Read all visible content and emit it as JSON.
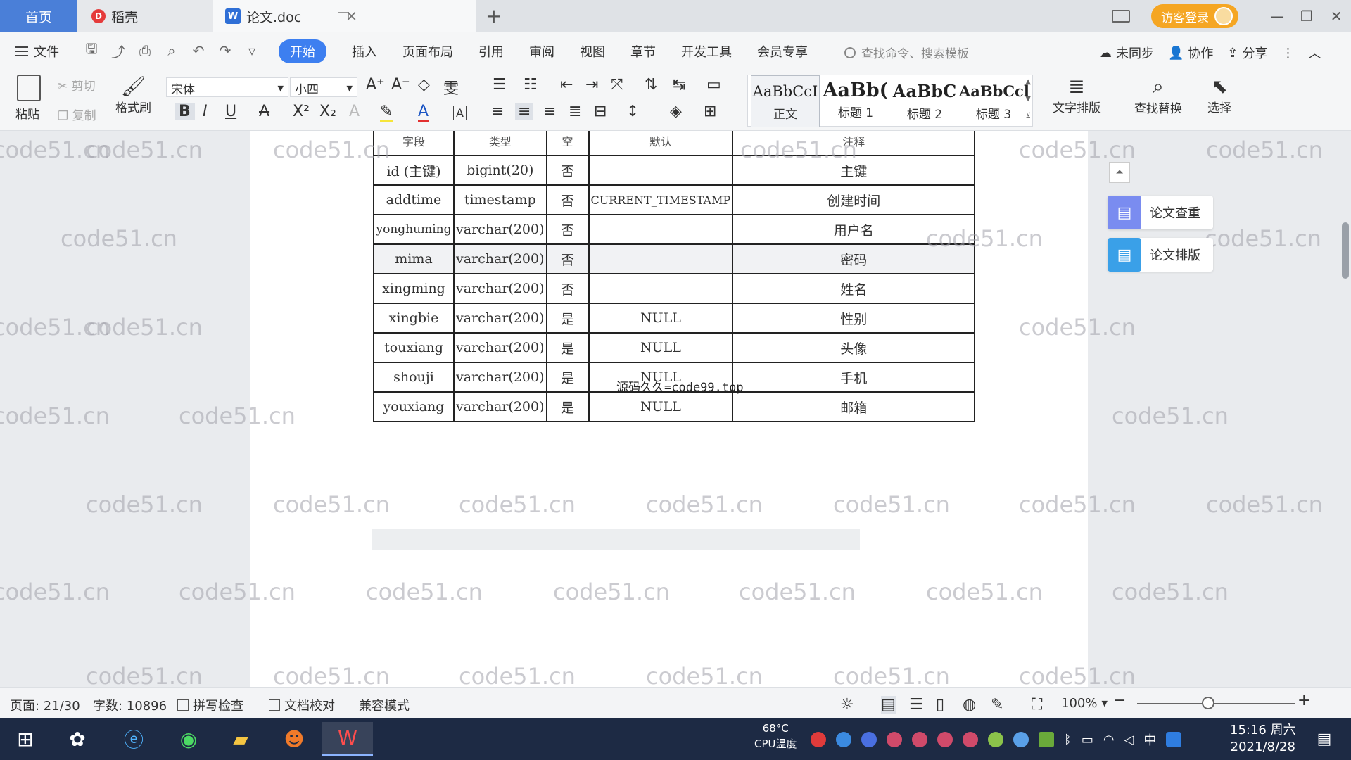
{
  "titlebar": {
    "tabs": [
      {
        "label": "首页"
      },
      {
        "label": "稻壳"
      },
      {
        "label": "论文.doc"
      }
    ],
    "visitor_login": "访客登录"
  },
  "menubar": {
    "file": "文件",
    "tabs": [
      "开始",
      "插入",
      "页面布局",
      "引用",
      "审阅",
      "视图",
      "章节",
      "开发工具",
      "会员专享"
    ],
    "search_placeholder": "查找命令、搜索模板",
    "sync": "未同步",
    "collab": "协作",
    "share": "分享"
  },
  "ribbon": {
    "paste": "粘贴",
    "cut": "剪切",
    "copy": "复制",
    "format_painter": "格式刷",
    "font_name": "宋体",
    "font_size": "小四",
    "styles": [
      {
        "sample": "AaBbCcI",
        "name": "正文"
      },
      {
        "sample": "AaBb(",
        "name": "标题 1"
      },
      {
        "sample": "AaBbC",
        "name": "标题 2"
      },
      {
        "sample": "AaBbCcl",
        "name": "标题 3"
      }
    ],
    "text_layout": "文字排版",
    "find_replace": "查找替换",
    "select": "选择"
  },
  "document": {
    "header_row": [
      "字段",
      "类型",
      "空",
      "默认",
      "注释"
    ],
    "rows": [
      [
        "id (主键)",
        "bigint(20)",
        "否",
        "",
        "主键"
      ],
      [
        "addtime",
        "timestamp",
        "否",
        "CURRENT_TIMESTAMP",
        "创建时间"
      ],
      [
        "yonghuming",
        "varchar(200)",
        "否",
        "",
        "用户名"
      ],
      [
        "mima",
        "varchar(200)",
        "否",
        "",
        "密码"
      ],
      [
        "xingming",
        "varchar(200)",
        "否",
        "",
        "姓名"
      ],
      [
        "xingbie",
        "varchar(200)",
        "是",
        "NULL",
        "性别"
      ],
      [
        "touxiang",
        "varchar(200)",
        "是",
        "NULL",
        "头像"
      ],
      [
        "shouji",
        "varchar(200)",
        "是",
        "NULL",
        "手机"
      ],
      [
        "youxiang",
        "varchar(200)",
        "是",
        "NULL",
        "邮箱"
      ]
    ],
    "overlay_text": "源码久久=code99.top",
    "watermark": "code51.cn"
  },
  "side_panel": {
    "check": "论文查重",
    "layout": "论文排版"
  },
  "statusbar": {
    "page": "页面: 21/30",
    "words": "字数: 10896",
    "spellcheck": "拼写检查",
    "proofread": "文档校对",
    "compat": "兼容模式",
    "zoom": "100%"
  },
  "taskbar": {
    "cpu_temp": "68°C",
    "cpu_label": "CPU温度",
    "ime": "中",
    "time": "15:16 周六",
    "date": "2021/8/28"
  },
  "colors": {
    "accent": "#3d7ff0",
    "home_tab": "#4a7fd8",
    "visitor": "#f5a623",
    "taskbar": "#1d2a44"
  }
}
